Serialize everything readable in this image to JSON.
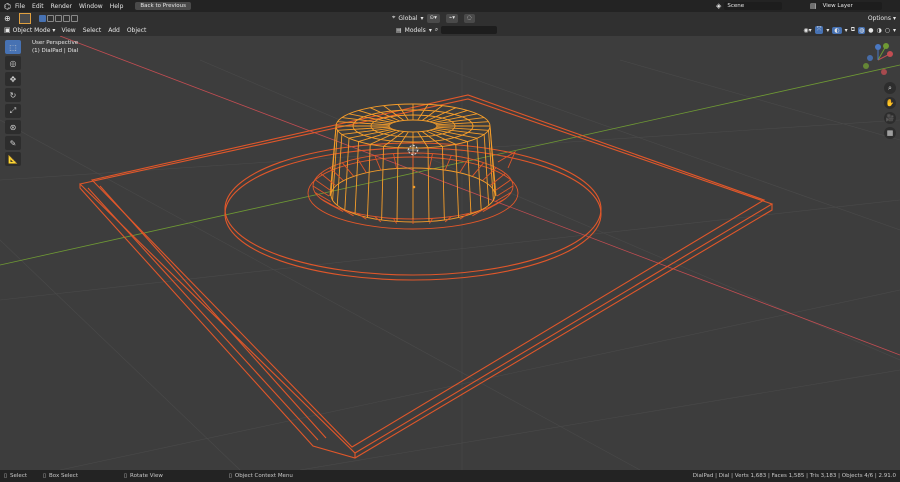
{
  "topbar": {
    "menus": [
      "File",
      "Edit",
      "Render",
      "Window",
      "Help"
    ],
    "back_button": "Back to Previous",
    "scene_label": "Scene",
    "view_layer_label": "View Layer"
  },
  "header": {
    "mode": "Object Mode",
    "menus": [
      "View",
      "Select",
      "Add",
      "Object"
    ],
    "orientation": "Global",
    "options_label": "Options",
    "collection": "Models"
  },
  "viewport": {
    "perspective_label": "User Perspective",
    "object_label": "(1) DialPad | Dial"
  },
  "statusbar": {
    "select": "Select",
    "box_select": "Box Select",
    "rotate_view": "Rotate View",
    "context_menu": "Object Context Menu",
    "stats": "DialPad | Dial | Verts 1,683 | Faces 1,585 | Tris 3,183 | Objects 4/6 | 2.91.0"
  },
  "colors": {
    "wire_selected": "#e0572a",
    "wire_active": "#f59d2a",
    "axis_x": "#c24d52",
    "axis_y": "#6f9a34",
    "grid": "#4a4a4a",
    "accent": "#4772b3"
  }
}
